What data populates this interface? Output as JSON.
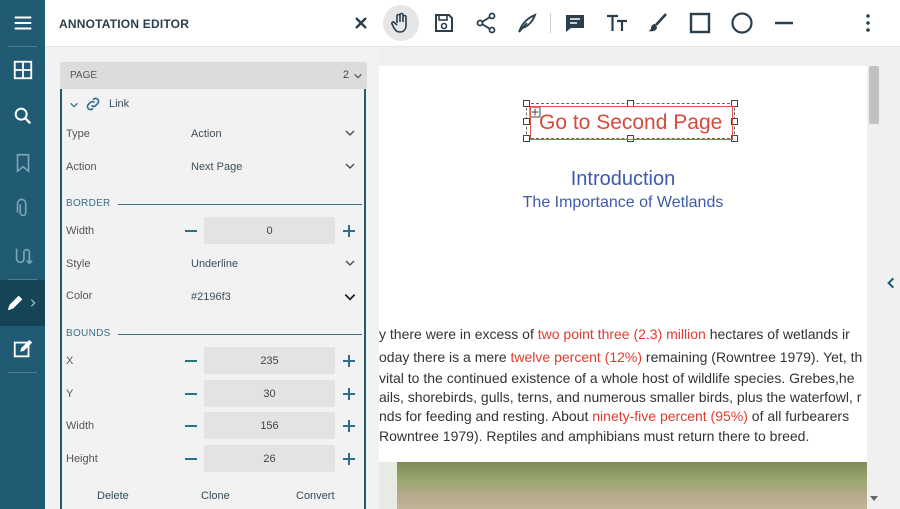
{
  "header": {
    "title": "ANNOTATION EDITOR"
  },
  "panel": {
    "page_label": "PAGE",
    "page_value": "2",
    "annotation_type": "Link",
    "type_label": "Type",
    "type_value": "Action",
    "action_label": "Action",
    "action_value": "Next Page",
    "border_section": "BORDER",
    "border_width_label": "Width",
    "border_width_value": "0",
    "style_label": "Style",
    "style_value": "Underline",
    "color_label": "Color",
    "color_value": "#2196f3",
    "bounds_section": "BOUNDS",
    "x_label": "X",
    "x_value": "235",
    "y_label": "Y",
    "y_value": "30",
    "bwidth_label": "Width",
    "bwidth_value": "156",
    "height_label": "Height",
    "height_value": "26",
    "delete_label": "Delete",
    "clone_label": "Clone",
    "convert_label": "Convert"
  },
  "document": {
    "link_text": "Go to Second Page",
    "intro_title": "Introduction",
    "intro_subtitle": "The Importance of Wetlands",
    "line1_a": "y there were in excess of ",
    "line1_red": "two point three (2.3) million",
    "line1_b": " hectares of wetlands ir",
    "line2_a": "oday there is a mere ",
    "line2_red": "twelve percent (12%)",
    "line2_b": " remaining (Rowntree 1979). Yet, th",
    "line3": "vital to the continued existence of a whole host of wildlife species. Grebes,he",
    "line4": "ails, shorebirds, gulls, terns, and numerous smaller birds, plus the waterfowl, r",
    "line5_a": "nds for feeding and resting. About ",
    "line5_red": "ninety-five percent (95%)",
    "line5_b": " of all furbearers",
    "line6": "Rowntree 1979). Reptiles and amphibians must return there to breed."
  },
  "colors": {
    "rail": "#205a73",
    "accent": "#2d6e8e",
    "link_red": "#d9493a"
  },
  "icons": {
    "rail": [
      "menu-icon",
      "thumbnails-icon",
      "search-icon",
      "bookmark-icon",
      "attachment-icon",
      "signature-icon",
      "edit-annotation-icon",
      "form-edit-icon"
    ],
    "toolbar": [
      "close-icon",
      "pan-hand-icon",
      "save-icon",
      "share-icon",
      "ink-pen-icon",
      "comment-icon",
      "text-size-icon",
      "brush-icon",
      "rectangle-icon",
      "circle-icon",
      "line-icon",
      "more-icon"
    ]
  }
}
